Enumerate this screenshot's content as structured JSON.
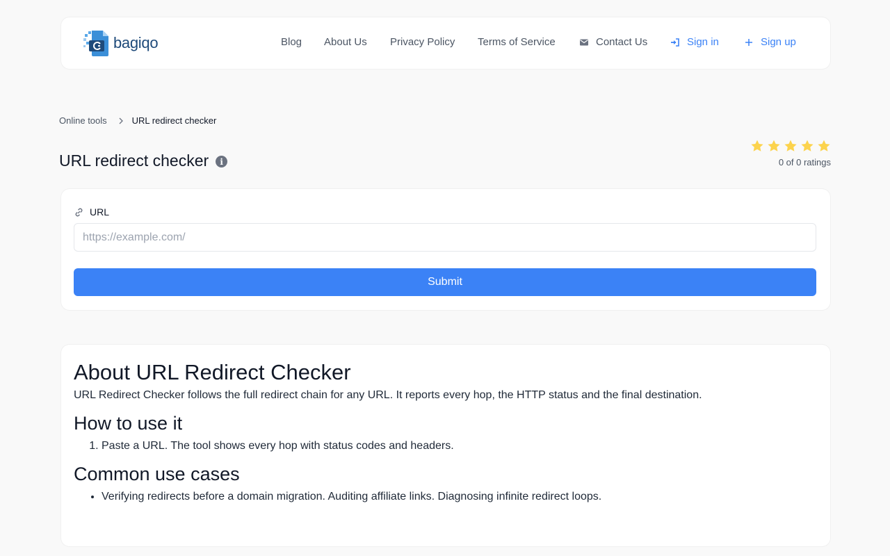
{
  "brand": {
    "name": "bagiqo"
  },
  "nav": {
    "blog": "Blog",
    "about": "About Us",
    "privacy": "Privacy Policy",
    "terms": "Terms of Service",
    "contact": "Contact Us",
    "sign_in": "Sign in",
    "sign_up": "Sign up"
  },
  "breadcrumb": {
    "parent": "Online tools",
    "separator": ">",
    "current": "URL redirect checker"
  },
  "page": {
    "title": "URL redirect checker",
    "info_glyph": "i"
  },
  "rating": {
    "stars_filled": 5,
    "stars_total": 5,
    "text": "0 of 0 ratings",
    "star_color": "#fcd34d"
  },
  "form": {
    "url_label": "URL",
    "url_placeholder": "https://example.com/",
    "url_value": "",
    "submit_label": "Submit"
  },
  "about": {
    "heading": "About URL Redirect Checker",
    "description": "URL Redirect Checker follows the full redirect chain for any URL. It reports every hop, the HTTP status and the final destination.",
    "how_heading": "How to use it",
    "how_steps": [
      "Paste a URL. The tool shows every hop with status codes and headers."
    ],
    "cases_heading": "Common use cases",
    "cases": [
      "Verifying redirects before a domain migration. Auditing affiliate links. Diagnosing infinite redirect loops."
    ]
  },
  "colors": {
    "accent": "#3b82f6",
    "background": "#f9f9f9",
    "card": "#ffffff",
    "brand_text": "#1e4a7a"
  }
}
